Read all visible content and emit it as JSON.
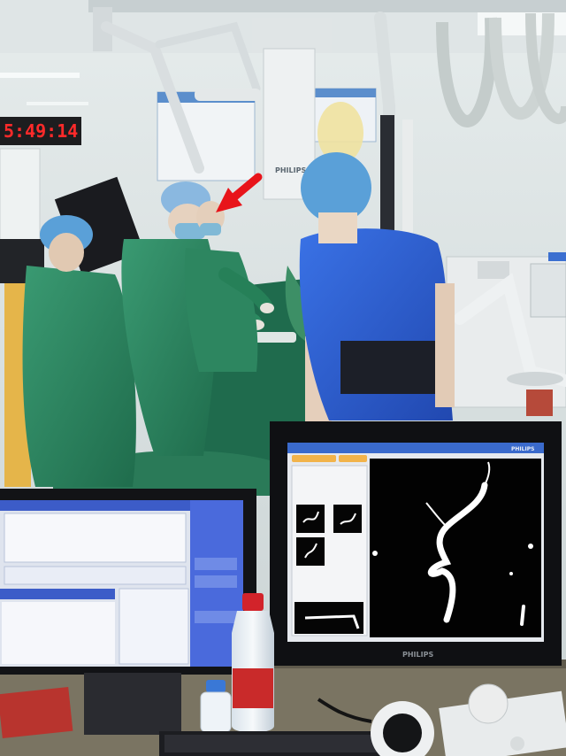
{
  "wall_clock": {
    "time": "5:49:14",
    "color": "#ff2a2a"
  },
  "gantry_brand": "PHILIPS",
  "monitor": {
    "brand": "PHILIPS",
    "screen_brand": "PHILIPS"
  },
  "annotation": {
    "arrow_color": "#e8141a"
  },
  "colors": {
    "gown": "#2f8a64",
    "vest": "#2b5fd6",
    "cap": "#5aa0d8"
  }
}
